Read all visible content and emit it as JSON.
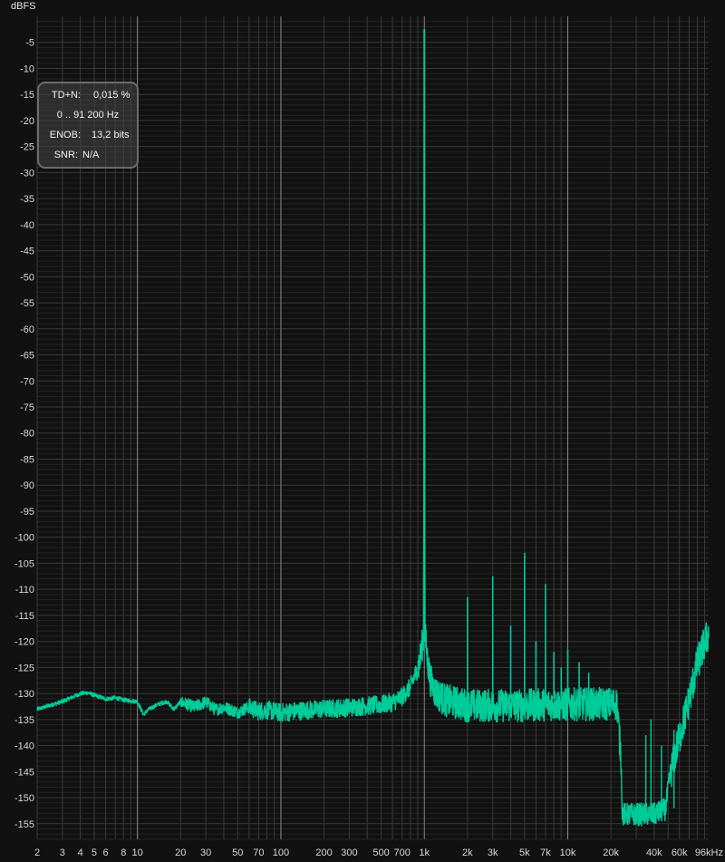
{
  "chart_data": {
    "type": "line",
    "ylabel": "dBFS",
    "xscale": "log",
    "xlim": [
      2,
      96000
    ],
    "ylim": [
      -158,
      0
    ],
    "x_ticks": [
      {
        "v": 2,
        "label": "2"
      },
      {
        "v": 3,
        "label": "3"
      },
      {
        "v": 4,
        "label": "4"
      },
      {
        "v": 5,
        "label": "5"
      },
      {
        "v": 6,
        "label": "6"
      },
      {
        "v": 8,
        "label": "8"
      },
      {
        "v": 10,
        "label": "10"
      },
      {
        "v": 20,
        "label": "20"
      },
      {
        "v": 30,
        "label": "30"
      },
      {
        "v": 50,
        "label": "50"
      },
      {
        "v": 70,
        "label": "70"
      },
      {
        "v": 100,
        "label": "100"
      },
      {
        "v": 200,
        "label": "200"
      },
      {
        "v": 300,
        "label": "300"
      },
      {
        "v": 500,
        "label": "500"
      },
      {
        "v": 700,
        "label": "700"
      },
      {
        "v": 1000,
        "label": "1k"
      },
      {
        "v": 2000,
        "label": "2k"
      },
      {
        "v": 3000,
        "label": "3k"
      },
      {
        "v": 5000,
        "label": "5k"
      },
      {
        "v": 7000,
        "label": "7k"
      },
      {
        "v": 10000,
        "label": "10k"
      },
      {
        "v": 20000,
        "label": "20k"
      },
      {
        "v": 40000,
        "label": "40k"
      },
      {
        "v": 60000,
        "label": "60k"
      },
      {
        "v": 96000,
        "label": "96kHz"
      }
    ],
    "y_ticks": [
      -5,
      -10,
      -15,
      -20,
      -25,
      -30,
      -35,
      -40,
      -45,
      -50,
      -55,
      -60,
      -65,
      -70,
      -75,
      -80,
      -85,
      -90,
      -95,
      -100,
      -105,
      -110,
      -115,
      -120,
      -125,
      -130,
      -135,
      -140,
      -145,
      -150,
      -155
    ],
    "grid": true,
    "series_color": "#00cc99",
    "spectrum": [
      [
        2,
        -133
      ],
      [
        3,
        -131.5
      ],
      [
        4,
        -130
      ],
      [
        4.5,
        -129.8
      ],
      [
        5,
        -130.3
      ],
      [
        6,
        -131
      ],
      [
        7,
        -130.8
      ],
      [
        8,
        -131.2
      ],
      [
        10,
        -131.5
      ],
      [
        11,
        -134
      ],
      [
        12,
        -133
      ],
      [
        14,
        -132
      ],
      [
        16,
        -131.5
      ],
      [
        18,
        -133
      ],
      [
        20,
        -131.5
      ],
      [
        25,
        -132.5
      ],
      [
        30,
        -131.5
      ],
      [
        35,
        -133
      ],
      [
        40,
        -132.5
      ],
      [
        50,
        -133.5
      ],
      [
        60,
        -132.5
      ],
      [
        70,
        -133.2
      ],
      [
        80,
        -133
      ],
      [
        100,
        -133.5
      ],
      [
        150,
        -133
      ],
      [
        200,
        -132.8
      ],
      [
        300,
        -132.5
      ],
      [
        400,
        -132.2
      ],
      [
        500,
        -132
      ],
      [
        600,
        -131.5
      ],
      [
        700,
        -130.5
      ],
      [
        800,
        -128.5
      ],
      [
        900,
        -125
      ],
      [
        950,
        -122
      ],
      [
        990,
        -118
      ],
      [
        1000,
        -2.5
      ],
      [
        1010,
        -118
      ],
      [
        1050,
        -123
      ],
      [
        1100,
        -127
      ],
      [
        1200,
        -129.5
      ],
      [
        1400,
        -131
      ],
      [
        1700,
        -131.5
      ],
      [
        2000,
        -132
      ],
      [
        2500,
        -132
      ],
      [
        3000,
        -132
      ],
      [
        4000,
        -132
      ],
      [
        5000,
        -132
      ],
      [
        7000,
        -131.8
      ],
      [
        10000,
        -131.8
      ],
      [
        15000,
        -131.7
      ],
      [
        20000,
        -131.7
      ],
      [
        22000,
        -131.6
      ],
      [
        23500,
        -142
      ],
      [
        24000,
        -153
      ],
      [
        30000,
        -153
      ],
      [
        40000,
        -153
      ],
      [
        48000,
        -152
      ],
      [
        52000,
        -145
      ],
      [
        60000,
        -138
      ],
      [
        70000,
        -131
      ],
      [
        80000,
        -124
      ],
      [
        90000,
        -120
      ],
      [
        96000,
        -118
      ]
    ],
    "harmonics": [
      {
        "f": 2000,
        "db": -111.5
      },
      {
        "f": 3000,
        "db": -107.5
      },
      {
        "f": 4000,
        "db": -117
      },
      {
        "f": 5000,
        "db": -103
      },
      {
        "f": 6000,
        "db": -120
      },
      {
        "f": 7000,
        "db": -109
      },
      {
        "f": 8000,
        "db": -122
      },
      {
        "f": 9000,
        "db": -125
      },
      {
        "f": 10000,
        "db": -121.5
      },
      {
        "f": 12000,
        "db": -124
      },
      {
        "f": 14000,
        "db": -126
      }
    ],
    "spurs": [
      {
        "f": 35000,
        "db": -138
      },
      {
        "f": 38000,
        "db": -135
      },
      {
        "f": 45000,
        "db": -140
      },
      {
        "f": 55000,
        "db": -137
      }
    ]
  },
  "stats": {
    "tdn_label": "TD+N:",
    "tdn_value": "0,015 %",
    "range": "0 .. 91 200 Hz",
    "enob_label": "ENOB:",
    "enob_value": "13,2 bits",
    "snr_label": "SNR:",
    "snr_value": "N/A"
  }
}
